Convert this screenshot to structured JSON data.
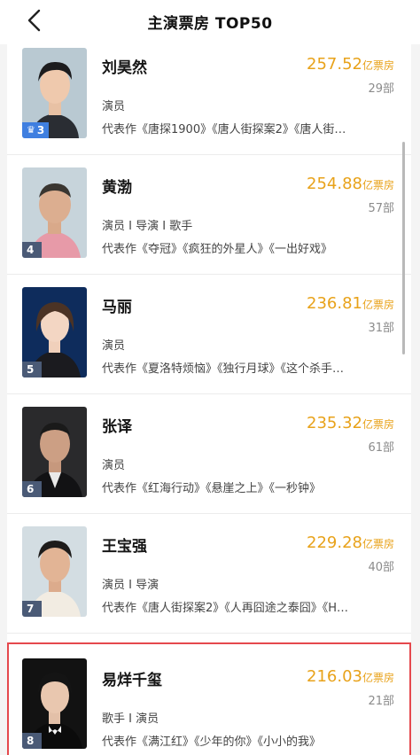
{
  "nav": {
    "title": "主演票房 TOP50",
    "back_icon": "chevron-left-icon"
  },
  "actors": [
    {
      "rank": "3",
      "name": "刘昊然",
      "box_value": "257.52",
      "box_unit": "亿票房",
      "film_count": "29部",
      "roles": "演员",
      "works": "代表作《唐探1900》《唐人街探案2》《唐人街…"
    },
    {
      "rank": "4",
      "name": "黄渤",
      "box_value": "254.88",
      "box_unit": "亿票房",
      "film_count": "57部",
      "roles": "演员 I 导演 I 歌手",
      "works": "代表作《夺冠》《疯狂的外星人》《一出好戏》"
    },
    {
      "rank": "5",
      "name": "马丽",
      "box_value": "236.81",
      "box_unit": "亿票房",
      "film_count": "31部",
      "roles": "演员",
      "works": "代表作《夏洛特烦恼》《独行月球》《这个杀手…"
    },
    {
      "rank": "6",
      "name": "张译",
      "box_value": "235.32",
      "box_unit": "亿票房",
      "film_count": "61部",
      "roles": "演员",
      "works": "代表作《红海行动》《悬崖之上》《一秒钟》"
    },
    {
      "rank": "7",
      "name": "王宝强",
      "box_value": "229.28",
      "box_unit": "亿票房",
      "film_count": "40部",
      "roles": "演员 I 导演",
      "works": "代表作《唐人街探案2》《人再囧途之泰囧》《H…"
    },
    {
      "rank": "8",
      "name": "易烊千玺",
      "box_value": "216.03",
      "box_unit": "亿票房",
      "film_count": "21部",
      "roles": "歌手 I 演员",
      "works": "代表作《满江红》《少年的你》《小小的我》"
    }
  ],
  "colors": {
    "box_office": "#e8a21a",
    "badge": "#4a5a76",
    "badge_top": "#3f7fe0",
    "highlight": "#e5484d"
  }
}
